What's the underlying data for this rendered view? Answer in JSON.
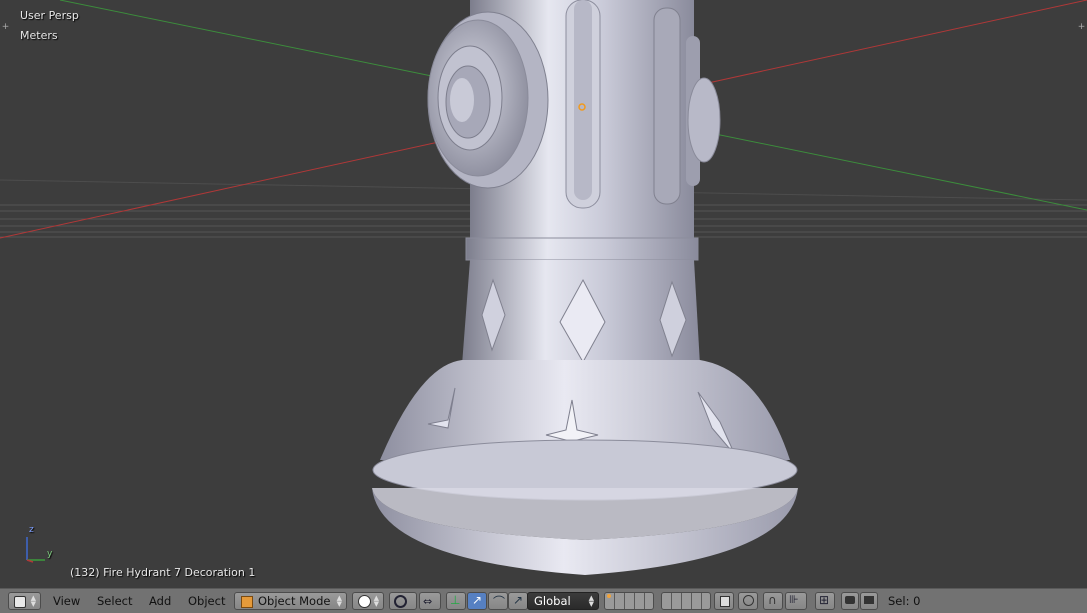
{
  "viewport": {
    "view_name": "User Persp",
    "units": "Meters",
    "object_info": "(132) Fire Hydrant 7 Decoration 1",
    "axis_labels": {
      "z": "z",
      "y": "y"
    }
  },
  "header": {
    "editor_type": "3d-view-icon",
    "menus": [
      "View",
      "Select",
      "Add",
      "Object"
    ],
    "mode": "Object Mode",
    "viewport_shading": "solid-sphere-icon",
    "pivot": "pivot-point-icon",
    "transform_orientation": "Global",
    "status": "Sel: 0"
  },
  "colors": {
    "background": "#3d3d3d",
    "header": "#727272",
    "x_axis": "#b03838",
    "y_axis": "#3c8c3c",
    "mesh": "#c6c7d6",
    "active_manipulator": "#5680c2"
  }
}
